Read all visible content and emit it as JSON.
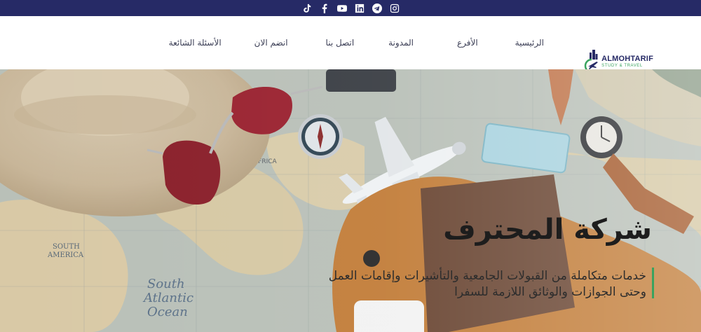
{
  "social": [
    {
      "name": "instagram-icon"
    },
    {
      "name": "telegram-icon"
    },
    {
      "name": "linkedin-icon"
    },
    {
      "name": "youtube-icon"
    },
    {
      "name": "facebook-icon"
    },
    {
      "name": "tiktok-icon"
    }
  ],
  "nav": {
    "items": [
      {
        "id": "home",
        "label": "الرئيسية"
      },
      {
        "id": "branches",
        "label": "الأفرع"
      },
      {
        "id": "blog",
        "label": "المدونة"
      },
      {
        "id": "contact",
        "label": "اتصل بنا"
      },
      {
        "id": "join",
        "label": "انضم الان"
      },
      {
        "id": "faq",
        "label": "الأسئلة الشائعة"
      }
    ]
  },
  "logo": {
    "name": "ALMOHTARIF",
    "tagline": "STUDY & TRAVEL"
  },
  "hero": {
    "title": "شركة المحترف",
    "subtitle": "خدمات متكاملة من القبولات الجامعية والتأشيرات وإقامات العمل وحتى الجوازات والوثائق اللازمة للسفرا"
  },
  "colors": {
    "topbar": "#262a66",
    "accent": "#3aa35f",
    "nav_text": "#3d4057"
  }
}
